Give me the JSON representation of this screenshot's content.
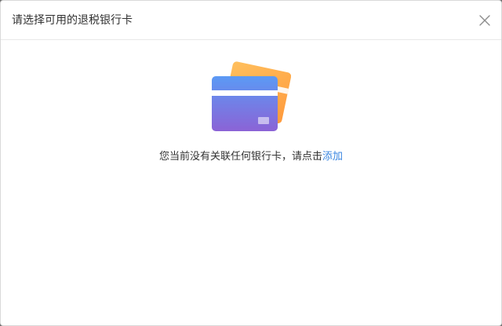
{
  "dialog": {
    "title": "请选择可用的退税银行卡",
    "close_icon": "close-icon"
  },
  "empty_state": {
    "illustration_icon": "bank-card-icon",
    "message": "您当前没有关联任何银行卡，请点击",
    "add_link_label": "添加"
  },
  "colors": {
    "link": "#3a86e0",
    "card_front_top": "#5b9af5",
    "card_front_bottom": "#8b63d6",
    "card_back": "#ffab4a"
  }
}
